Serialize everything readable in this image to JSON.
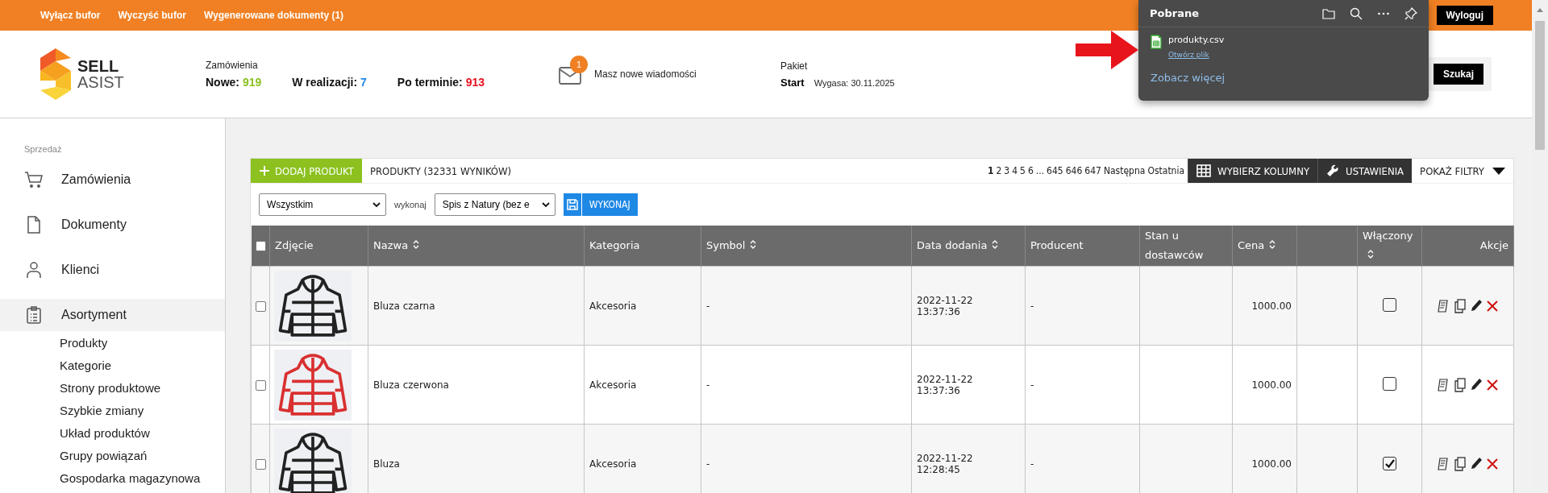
{
  "topbar": {
    "links": [
      "Wyłącz bufor",
      "Wyczyść bufor",
      "Wygenerowane dokumenty (1)"
    ],
    "logout": "Wyloguj"
  },
  "header": {
    "logo": {
      "line1": "SELL",
      "line2": "ASIST"
    },
    "orders": {
      "title": "Zamówienia",
      "stats": [
        {
          "label": "Nowe:",
          "value": "919",
          "color": "#8cc11f"
        },
        {
          "label": "W realizacji:",
          "value": "7",
          "color": "#1e88e5"
        },
        {
          "label": "Po terminie:",
          "value": "913",
          "color": "#e8101e"
        }
      ]
    },
    "messages": {
      "badge": "1",
      "text": "Masz nowe wiadomości"
    },
    "package": {
      "title": "Pakiet",
      "name": "Start",
      "expires": "Wygasa: 30.11.2025"
    },
    "search": {
      "button": "Szukaj"
    }
  },
  "downloads": {
    "title": "Pobrane",
    "file": {
      "name": "produkty.csv",
      "action": "Otwórz plik"
    },
    "more": "Zobacz więcej"
  },
  "sidebar": {
    "section": "Sprzedaż",
    "items": [
      {
        "label": "Zamówienia",
        "kind": "cart",
        "selected": false
      },
      {
        "label": "Dokumenty",
        "kind": "document",
        "selected": false
      },
      {
        "label": "Klienci",
        "kind": "person",
        "selected": false
      },
      {
        "label": "Asortyment",
        "kind": "clipboard",
        "selected": true,
        "expanded": true,
        "children": [
          "Produkty",
          "Kategorie",
          "Strony produktowe",
          "Szybkie zmiany",
          "Układ produktów",
          "Grupy powiązań",
          "Gospodarka magazynowa"
        ]
      }
    ]
  },
  "products": {
    "add_button": "DODAJ PRODUKT",
    "title": "PRODUKTY (32331 WYNIKÓW)",
    "pages": [
      {
        "label": "1",
        "selected": true
      },
      {
        "label": "2",
        "selected": false
      },
      {
        "label": "3",
        "selected": false
      },
      {
        "label": "4",
        "selected": false
      },
      {
        "label": "5",
        "selected": false
      },
      {
        "label": "6",
        "selected": false
      },
      {
        "label": "...",
        "selected": false
      },
      {
        "label": "645",
        "selected": false
      },
      {
        "label": "646",
        "selected": false
      },
      {
        "label": "647",
        "selected": false
      },
      {
        "label": "Następna",
        "selected": false
      },
      {
        "label": "Ostatnia",
        "selected": false
      }
    ],
    "columns_button": "WYBIERZ KOLUMNY",
    "settings_button": "USTAWIENIA",
    "filters_button": "POKAŻ FILTRY",
    "bulk": {
      "scope": "Wszystkim",
      "label": "wykonaj",
      "action": "Spis z Natury (bez e",
      "execute": "WYKONAJ"
    },
    "select_all": {
      "checked": false
    },
    "columns": [
      {
        "label": "Zdjęcie",
        "sortable": false
      },
      {
        "label": "Nazwa",
        "sortable": true
      },
      {
        "label": "Kategoria",
        "sortable": false
      },
      {
        "label": "Symbol",
        "sortable": true
      },
      {
        "label": "Data dodania",
        "sortable": true
      },
      {
        "label": "Producent",
        "sortable": false
      },
      {
        "label": "Stan u dostawców",
        "sortable": false
      },
      {
        "label": "Cena",
        "sortable": true
      },
      {
        "sortable": false
      },
      {
        "label": "Włączony",
        "sortable": true
      },
      {
        "label": "Akcje",
        "sortable": false
      }
    ],
    "rows": [
      {
        "selected": false,
        "color": "#222222",
        "name": "Bluza czarna",
        "category": "Akcesoria",
        "symbol": "-",
        "date": "2022-11-22",
        "time": "13:37:36",
        "producer": "-",
        "price": "1000.00",
        "enabled": false
      },
      {
        "selected": false,
        "color": "#d93030",
        "name": "Bluza czerwona",
        "category": "Akcesoria",
        "symbol": "-",
        "date": "2022-11-22",
        "time": "13:37:36",
        "producer": "-",
        "price": "1000.00",
        "enabled": false
      },
      {
        "selected": false,
        "color": "#222222",
        "name": "Bluza",
        "category": "Akcesoria",
        "symbol": "-",
        "date": "2022-11-22",
        "time": "12:28:45",
        "producer": "-",
        "price": "1000.00",
        "enabled": true
      }
    ]
  }
}
